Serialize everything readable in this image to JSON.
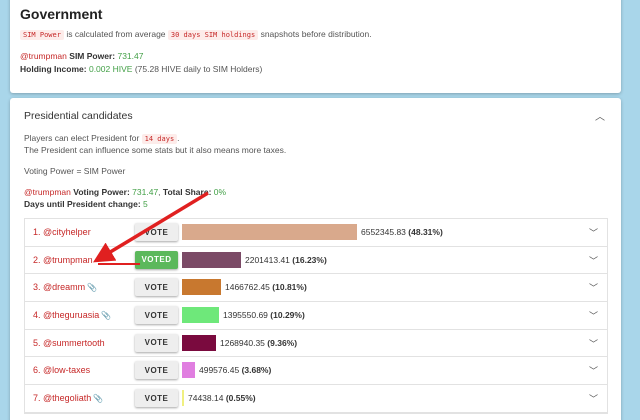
{
  "government": {
    "title": "Government",
    "code1": "SIM Power",
    "text1": "is calculated from average",
    "code2": "30 days SIM holdings",
    "text2": "snapshots before distribution.",
    "user": "@trumpman",
    "sim_power_label": "SIM Power:",
    "sim_power_value": "731.47",
    "holding_label": "Holding Income:",
    "holding_value": "0.002 HIVE",
    "holding_note": "(75.28 HIVE daily to SIM Holders)"
  },
  "presidential": {
    "title": "Presidential candidates",
    "elect_text": "Players can elect President for",
    "elect_code": "14 days",
    "elect_period": ".",
    "influence_text": "The President can influence some stats but it also means more taxes.",
    "voting_power_text": "Voting Power = SIM Power",
    "user": "@trumpman",
    "voting_power_label": "Voting Power:",
    "voting_power_value": "731.47",
    "total_share_label": "Total Share:",
    "total_share_value": "0%",
    "days_label": "Days until President change:",
    "days_value": "5",
    "candidates": [
      {
        "rank": "1.",
        "name": "@cityhelper",
        "button": "VOTE",
        "voted": false,
        "clip": false,
        "votes": "6552345.83",
        "share": "(48.31%)",
        "share_value": 48.31,
        "color": "#d9a98c"
      },
      {
        "rank": "2.",
        "name": "@trumpman",
        "button": "VOTED",
        "voted": true,
        "clip": false,
        "votes": "2201413.41",
        "share": "(16.23%)",
        "share_value": 16.23,
        "color": "#7b4a66"
      },
      {
        "rank": "3.",
        "name": "@dreamm",
        "button": "VOTE",
        "voted": false,
        "clip": true,
        "votes": "1466762.45",
        "share": "(10.81%)",
        "share_value": 10.81,
        "color": "#c8782f"
      },
      {
        "rank": "4.",
        "name": "@theguruasia",
        "button": "VOTE",
        "voted": false,
        "clip": true,
        "votes": "1395550.69",
        "share": "(10.29%)",
        "share_value": 10.29,
        "color": "#6ee87a"
      },
      {
        "rank": "5.",
        "name": "@summertooth",
        "button": "VOTE",
        "voted": false,
        "clip": false,
        "votes": "1268940.35",
        "share": "(9.36%)",
        "share_value": 9.36,
        "color": "#7a0a3e"
      },
      {
        "rank": "6.",
        "name": "@low-taxes",
        "button": "VOTE",
        "voted": false,
        "clip": false,
        "votes": "499576.45",
        "share": "(3.68%)",
        "share_value": 3.68,
        "color": "#e07ee0"
      },
      {
        "rank": "7.",
        "name": "@thegoliath",
        "button": "VOTE",
        "voted": false,
        "clip": true,
        "votes": "74438.14",
        "share": "(0.55%)",
        "share_value": 0.55,
        "color": "#f0f080"
      }
    ]
  },
  "icons": {
    "chevron": "chevron-icon",
    "paperclip": "paperclip-icon",
    "annotation_arrow": "red-arrow"
  },
  "colors": {
    "background": "#a9d6ea",
    "username": "#c62828",
    "value_green": "#43a047",
    "voted_button": "#5cb85c",
    "annotation_arrow": "#e02020"
  }
}
